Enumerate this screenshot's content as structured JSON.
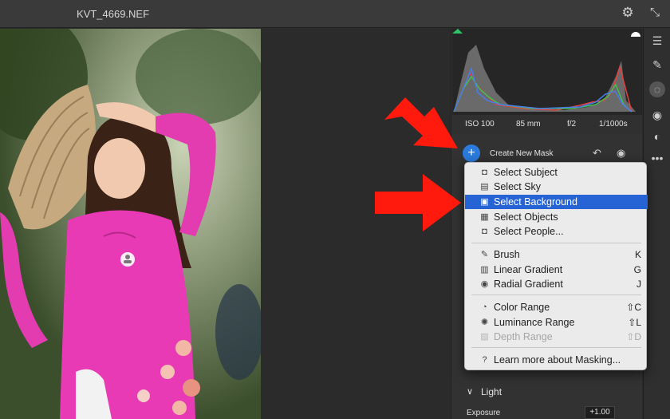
{
  "window": {
    "filename": "KVT_4669.NEF"
  },
  "icons": {
    "settings": "gear-icon",
    "collapse": "collapse-icon"
  },
  "exif": {
    "iso": "ISO 100",
    "focal": "85 mm",
    "aperture": "f/2",
    "shutter": "1/1000s"
  },
  "mask": {
    "create_label": "Create New Mask"
  },
  "menu": {
    "items": [
      {
        "label": "Select Subject",
        "icon": "person-icon",
        "shortcut": ""
      },
      {
        "label": "Select Sky",
        "icon": "sky-icon",
        "shortcut": ""
      },
      {
        "label": "Select Background",
        "icon": "background-icon",
        "shortcut": "",
        "selected": true
      },
      {
        "label": "Select Objects",
        "icon": "objects-icon",
        "shortcut": ""
      },
      {
        "label": "Select People...",
        "icon": "people-icon",
        "shortcut": ""
      },
      {
        "label": "Brush",
        "icon": "brush-icon",
        "shortcut": "K"
      },
      {
        "label": "Linear Gradient",
        "icon": "linear-gradient-icon",
        "shortcut": "G"
      },
      {
        "label": "Radial Gradient",
        "icon": "radial-gradient-icon",
        "shortcut": "J"
      },
      {
        "label": "Color Range",
        "icon": "color-range-icon",
        "shortcut": "⇧C"
      },
      {
        "label": "Luminance Range",
        "icon": "luminance-range-icon",
        "shortcut": "⇧L"
      },
      {
        "label": "Depth Range",
        "icon": "depth-range-icon",
        "shortcut": "⇧D",
        "disabled": true
      },
      {
        "label": "Learn more about Masking...",
        "icon": "help-icon",
        "shortcut": ""
      }
    ]
  },
  "panel": {
    "light_label": "Light",
    "exposure_label": "Exposure",
    "exposure_value": "+1.00"
  },
  "colors": {
    "accent": "#2a7bdc",
    "selection": "#2664d5",
    "arrow": "#ff1a0d"
  }
}
